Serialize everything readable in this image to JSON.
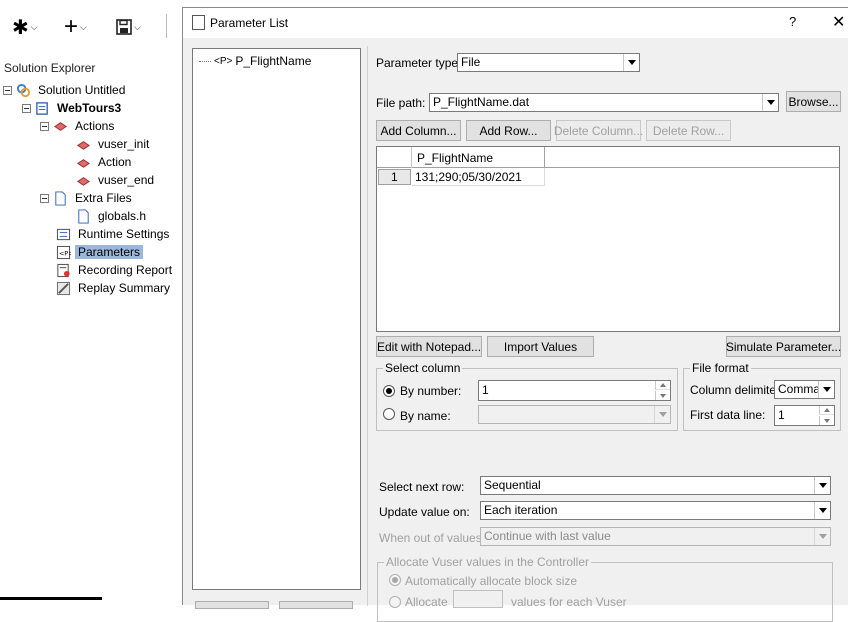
{
  "ide": {
    "toolbar": [
      {
        "icon": "asterisk-icon",
        "glyph": "✱"
      },
      {
        "icon": "plus-icon",
        "glyph": "+"
      },
      {
        "icon": "save-icon",
        "glyph": "💾"
      }
    ],
    "solution_explorer_title": "Solution Explorer",
    "tree": {
      "solution": "Solution Untitled",
      "project": "WebTours3",
      "actions_folder": "Actions",
      "actions": [
        "vuser_init",
        "Action",
        "vuser_end"
      ],
      "extra_files_folder": "Extra Files",
      "extra_files": [
        "globals.h"
      ],
      "runtime_settings": "Runtime Settings",
      "parameters": "Parameters",
      "recording_report": "Recording Report",
      "replay_summary": "Replay Summary"
    }
  },
  "dialog": {
    "title": "Parameter List",
    "help": "?",
    "close": "✕",
    "parameters": [
      {
        "name": "P_FlightName",
        "tag": "<P>"
      }
    ],
    "parameter_type": {
      "label": "Parameter type:",
      "value": "File"
    },
    "file_path": {
      "label": "File path:",
      "value": "P_FlightName.dat",
      "browse": "Browse..."
    },
    "grid_buttons": {
      "add_column": "Add Column...",
      "add_row": "Add Row...",
      "delete_column": "Delete Column...",
      "delete_row": "Delete Row..."
    },
    "grid": {
      "columns": [
        "P_FlightName"
      ],
      "rows": [
        {
          "num": "1",
          "values": [
            "131;290;05/30/2021"
          ]
        }
      ]
    },
    "bottom_buttons": {
      "edit_notepad": "Edit with Notepad...",
      "import_values": "Import Values",
      "simulate": "Simulate Parameter..."
    },
    "select_column": {
      "caption": "Select column",
      "by_number": {
        "label": "By number:",
        "value": "1",
        "selected": true
      },
      "by_name": {
        "label": "By name:",
        "value": "",
        "selected": false
      }
    },
    "file_format": {
      "caption": "File format",
      "delimiter": {
        "label": "Column delimiter:",
        "value": "Comma"
      },
      "first_line": {
        "label": "First data line:",
        "value": "1"
      }
    },
    "next_row": {
      "label": "Select next row:",
      "value": "Sequential"
    },
    "update_value": {
      "label": "Update value on:",
      "value": "Each iteration"
    },
    "out_of_values": {
      "label": "When out of values:",
      "value": "Continue with last value"
    },
    "allocate": {
      "caption": "Allocate Vuser values in the Controller",
      "auto": "Automatically allocate block size",
      "manual_prefix": "Allocate",
      "manual_suffix": "values for each Vuser"
    }
  }
}
